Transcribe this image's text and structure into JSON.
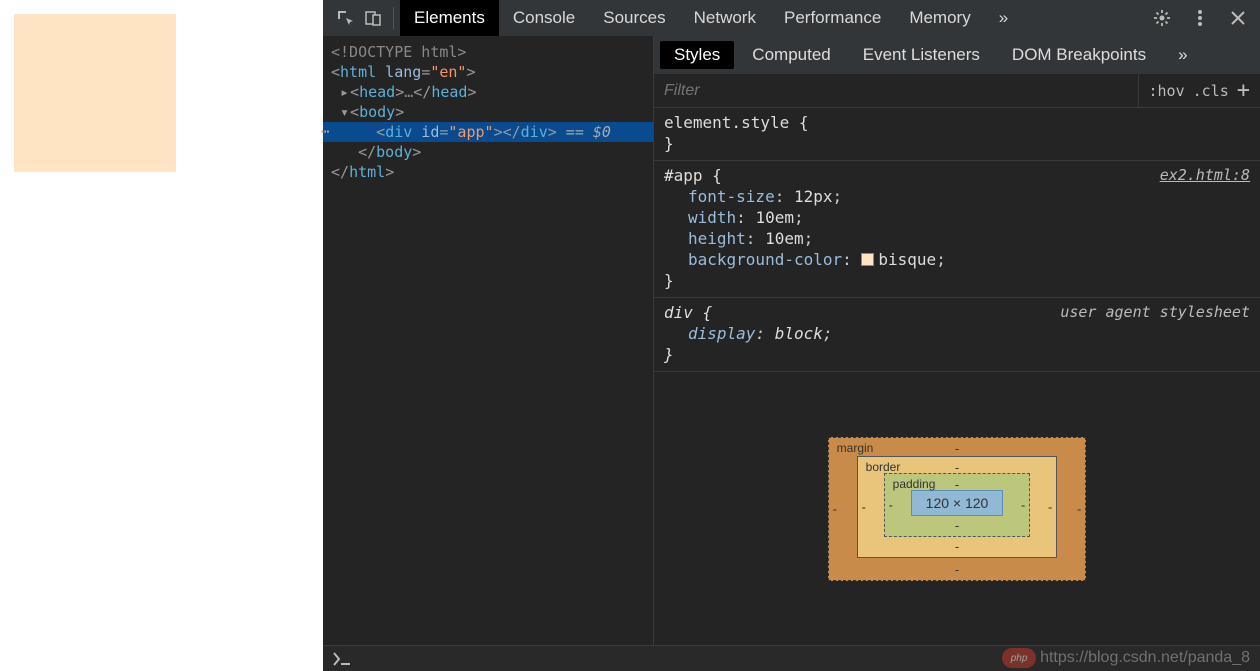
{
  "toolbar": {
    "tabs": [
      "Elements",
      "Console",
      "Sources",
      "Network",
      "Performance",
      "Memory"
    ],
    "more": "»"
  },
  "dom": {
    "doctype": "<!DOCTYPE html>",
    "html_open_1": "<",
    "html_tag": "html",
    "html_attr": " lang",
    "html_eq": "=",
    "html_val": "\"en\"",
    "html_close": ">",
    "head_open": "<",
    "head_tag": "head",
    "head_close": ">",
    "head_ellipsis": "…",
    "head_end_open": "</",
    "body_open": "<",
    "body_tag": "body",
    "body_close": ">",
    "sel_open": "<",
    "sel_tag": "div",
    "sel_attr": " id",
    "sel_eq": "=",
    "sel_val": "\"app\"",
    "sel_close": ">",
    "sel_end_open": "</",
    "sel_trail": " == $0",
    "body_end_open": "</",
    "html_end_open": "</"
  },
  "stylesTabs": [
    "Styles",
    "Computed",
    "Event Listeners",
    "DOM Breakpoints"
  ],
  "filter": {
    "placeholder": "Filter",
    "hov": ":hov",
    "cls": ".cls"
  },
  "rules": {
    "elStyle": {
      "sel": "element.style {",
      "close": "}"
    },
    "app": {
      "sel": "#app {",
      "src": "ex2.html:8",
      "p1n": "font-size",
      "p1v": "12px",
      "p2n": "width",
      "p2v": "10em",
      "p3n": "height",
      "p3v": "10em",
      "p4n": "background-color",
      "p4v": "bisque",
      "swatch": "#ffe4c4",
      "close": "}"
    },
    "div": {
      "sel": "div {",
      "src": "user agent stylesheet",
      "p1n": "display",
      "p1v": "block",
      "close": "}"
    }
  },
  "boxModel": {
    "margin": "margin",
    "border": "border",
    "padding": "padding",
    "dash": "-",
    "content": "120 × 120"
  },
  "watermark": {
    "logo": "php",
    "url": "https://blog.csdn.net/panda_8"
  }
}
